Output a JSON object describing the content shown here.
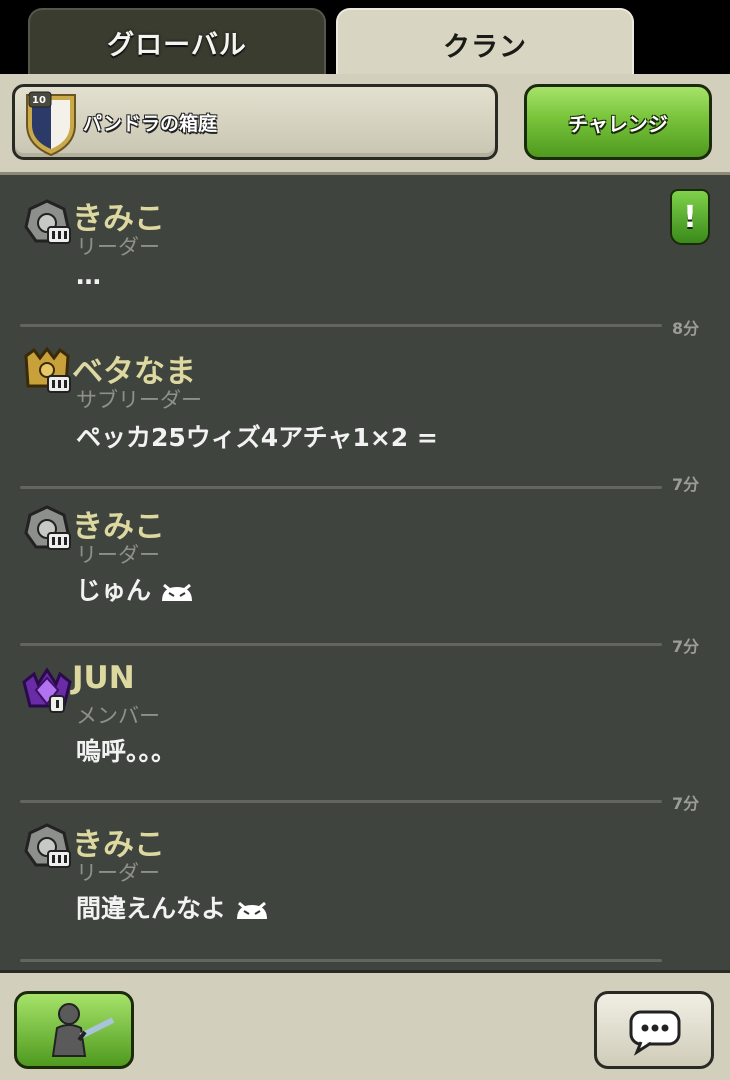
{
  "tabs": {
    "global": "グローバル",
    "clan": "クラン"
  },
  "header": {
    "clan_name": "パンドラの箱庭",
    "clan_level": "10",
    "challenge_label": "チャレンジ"
  },
  "messages": [
    {
      "author": "きみこ",
      "role": "リーダー",
      "text": "…",
      "time": "8分",
      "badge": "leader-badge-icon"
    },
    {
      "author": "ベタなま",
      "role": "サブリーダー",
      "text": "ペッカ25ウィズ4アチャ1×2 =",
      "time": "7分",
      "badge": "co-leader-badge-icon"
    },
    {
      "author": "きみこ",
      "role": "リーダー",
      "text": "じゅん",
      "time": "7分",
      "badge": "leader-badge-icon"
    },
    {
      "author": "JUN",
      "role": "メンバー",
      "text": "嗚呼。。。",
      "time": "7分",
      "badge": "member-badge-icon"
    },
    {
      "author": "きみこ",
      "role": "リーダー",
      "text": "間違えんなよ",
      "time": "7分",
      "badge": "leader-badge-icon"
    }
  ],
  "icons": {
    "alert": "!",
    "war": "troop-sword-icon",
    "chat": "speech-bubble-icon"
  },
  "colors": {
    "chat_bg": "#3f443e",
    "author": "#dcd8a0",
    "accent_green": "#78c33a"
  }
}
